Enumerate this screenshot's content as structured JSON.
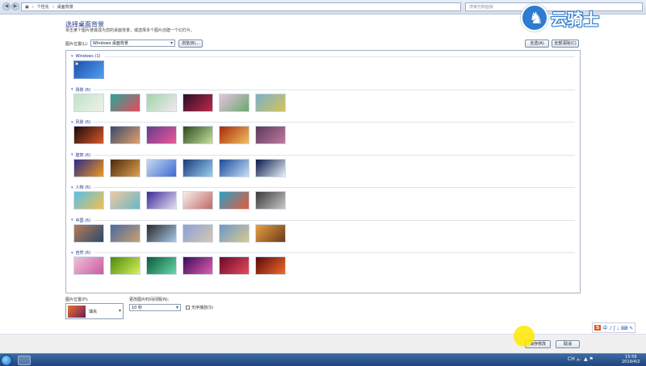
{
  "addressbar": {
    "back": "◀",
    "forward": "▶",
    "crumbs": [
      "个性化",
      "桌面背景"
    ],
    "search_placeholder": "搜索控制面板"
  },
  "main": {
    "title": "选择桌面背景",
    "subtitle": "单击某个图片使其成为您的桌面背景，或选择多个图片创建一个幻灯片。",
    "location_label": "图片位置(L):",
    "location_value": "Windows 桌面背景",
    "browse_label": "浏览(B)...",
    "select_all_label": "全选(A)",
    "clear_all_label": "全部清除(C)"
  },
  "groups": [
    {
      "name": "Windows (1)",
      "count": 1,
      "colors": [
        [
          "#1d4fb0",
          "#4fa0ee"
        ]
      ]
    },
    {
      "name": "场景 (6)",
      "count": 6,
      "colors": [
        [
          "#bfe3c8",
          "#f0f0e8"
        ],
        [
          "#28a898",
          "#e7495e"
        ],
        [
          "#9ed7a4",
          "#f3e6f4"
        ],
        [
          "#2a0e2a",
          "#c0284a"
        ],
        [
          "#e6c3df",
          "#6aa86e"
        ],
        [
          "#7ab0c8",
          "#d6c35c"
        ]
      ]
    },
    {
      "name": "风景 (6)",
      "count": 6,
      "colors": [
        [
          "#1a0a0a",
          "#d85a2a"
        ],
        [
          "#3a4a6a",
          "#e0a070"
        ],
        [
          "#6a3a8a",
          "#e85a9a"
        ],
        [
          "#2a4a1a",
          "#c8e0a0"
        ],
        [
          "#a82a0a",
          "#f0c060"
        ],
        [
          "#5a3a5a",
          "#c07aa0"
        ]
      ]
    },
    {
      "name": "建筑 (6)",
      "count": 6,
      "colors": [
        [
          "#2a2a8a",
          "#f09a1a"
        ],
        [
          "#4a2a0a",
          "#e0a050"
        ],
        [
          "#c8d8f0",
          "#3a6ad0"
        ],
        [
          "#1a3a7a",
          "#9ad0f0"
        ],
        [
          "#1a4a9a",
          "#c8e0f8"
        ],
        [
          "#0a1a4a",
          "#e8f0f8"
        ]
      ]
    },
    {
      "name": "人物 (6)",
      "count": 6,
      "colors": [
        [
          "#58c0e8",
          "#f0c050"
        ],
        [
          "#f0c8a0",
          "#68b8c8"
        ],
        [
          "#3a2a9a",
          "#e8e0f0"
        ],
        [
          "#f8f0e8",
          "#c06a6a"
        ],
        [
          "#2aa0c8",
          "#e85a3a"
        ],
        [
          "#3a3a3a",
          "#c8c8c8"
        ]
      ]
    },
    {
      "name": "中国 (6)",
      "count": 6,
      "colors": [
        [
          "#b87a5a",
          "#2a4a6a"
        ],
        [
          "#4a6aa0",
          "#c8a070"
        ],
        [
          "#2a2a2a",
          "#a8c8e8"
        ],
        [
          "#8aa0d8",
          "#d8c8b0"
        ],
        [
          "#6a9ac8",
          "#d8c890"
        ],
        [
          "#e8a040",
          "#6a3a1a"
        ]
      ]
    },
    {
      "name": "自然 (6)",
      "count": 6,
      "colors": [
        [
          "#f0c0d8",
          "#c85aa0"
        ],
        [
          "#4a8a0a",
          "#d8f05a"
        ],
        [
          "#0a5a3a",
          "#68d8a8"
        ],
        [
          "#3a0a5a",
          "#e060b0"
        ],
        [
          "#6a0a2a",
          "#e84a5a"
        ],
        [
          "#5a0a0a",
          "#f06a2a"
        ]
      ]
    }
  ],
  "bottom": {
    "position_label": "图片位置(P):",
    "position_value": "填充",
    "interval_label": "更改图片时间间隔(N):",
    "interval_value": "10 秒",
    "shuffle_label": "无序播放(S)",
    "save_label": "保存修改",
    "cancel_label": "取消"
  },
  "watermark": {
    "text": "云骑士"
  },
  "ime": {
    "brand": "S",
    "label": "中 ♪ ʃ ♩ ⌨ ✎"
  },
  "taskbar": {
    "time": "15:59",
    "date": "2019/4/2",
    "tray": "CH 🔈 ▲ ⚑"
  }
}
